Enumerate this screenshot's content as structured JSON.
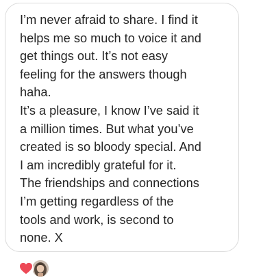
{
  "message": {
    "paragraphs": [
      "I’m never afraid to share. I find it\nhelps me so much to voice it and\nget things out. It’s not easy\nfeeling for the answers though\nhaha.",
      "It’s a pleasure, I know I’ve said it\na million times. But what you’ve\ncreated is so bloody special. And\nI am incredibly grateful for it.",
      "The friendships and connections\nI’m getting regardless of the\ntools and work, is second to\nnone. X"
    ]
  },
  "reactions": {
    "emoji": "heart-icon",
    "heart_color": "#ed4956",
    "reactor": "avatar"
  },
  "colors": {
    "text": "#262626",
    "bubble_border": "#dbdbdb",
    "background": "#ffffff"
  }
}
